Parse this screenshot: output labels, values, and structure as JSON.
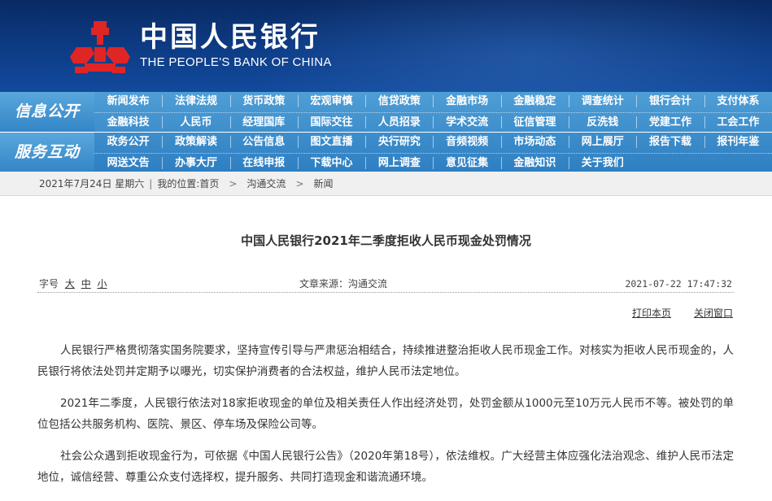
{
  "header": {
    "logo_cn": "中国人民银行",
    "logo_en": "THE PEOPLE'S BANK OF CHINA",
    "brand_color": "#0d3c86",
    "logo_color": "#e02525"
  },
  "nav": {
    "sections": [
      {
        "category": "信息公开",
        "rows": [
          [
            "新闻发布",
            "法律法规",
            "货币政策",
            "宏观审慎",
            "信贷政策",
            "金融市场",
            "金融稳定",
            "调查统计",
            "银行会计",
            "支付体系"
          ],
          [
            "金融科技",
            "人民币",
            "经理国库",
            "国际交往",
            "人员招录",
            "学术交流",
            "征信管理",
            "反洗钱",
            "党建工作",
            "工会工作"
          ]
        ]
      },
      {
        "category": "服务互动",
        "rows": [
          [
            "政务公开",
            "政策解读",
            "公告信息",
            "图文直播",
            "央行研究",
            "音频视频",
            "市场动态",
            "网上展厅",
            "报告下载",
            "报刊年鉴"
          ],
          [
            "网送文告",
            "办事大厅",
            "在线申报",
            "下载中心",
            "网上调查",
            "意见征集",
            "金融知识",
            "关于我们"
          ]
        ]
      }
    ]
  },
  "breadcrumb": {
    "date": "2021年7月24日 星期六",
    "location_label": "我的位置:首页",
    "level2": "沟通交流",
    "level3": "新闻",
    "arrow": ">"
  },
  "article": {
    "title": "中国人民银行2021年二季度拒收人民币现金处罚情况",
    "font_size_label": "字号",
    "font_sizes": [
      "大",
      "中",
      "小"
    ],
    "source": "文章来源：沟通交流",
    "datetime": "2021-07-22 17:47:32",
    "print_label": "打印本页",
    "close_label": "关闭窗口",
    "paragraphs": [
      "人民银行严格贯彻落实国务院要求，坚持宣传引导与严肃惩治相结合，持续推进整治拒收人民币现金工作。对核实为拒收人民币现金的，人民银行将依法处罚并定期予以曝光，切实保护消费者的合法权益，维护人民币法定地位。",
      "2021年二季度，人民银行依法对18家拒收现金的单位及相关责任人作出经济处罚，处罚金额从1000元至10万元人民币不等。被处罚的单位包括公共服务机构、医院、景区、停车场及保险公司等。",
      "社会公众遇到拒收现金行为，可依据《中国人民银行公告》（2020年第18号），依法维权。广大经营主体应强化法治观念、维护人民币法定地位，诚信经营、尊重公众支付选择权，提升服务、共同打造现金和谐流通环境。"
    ]
  }
}
